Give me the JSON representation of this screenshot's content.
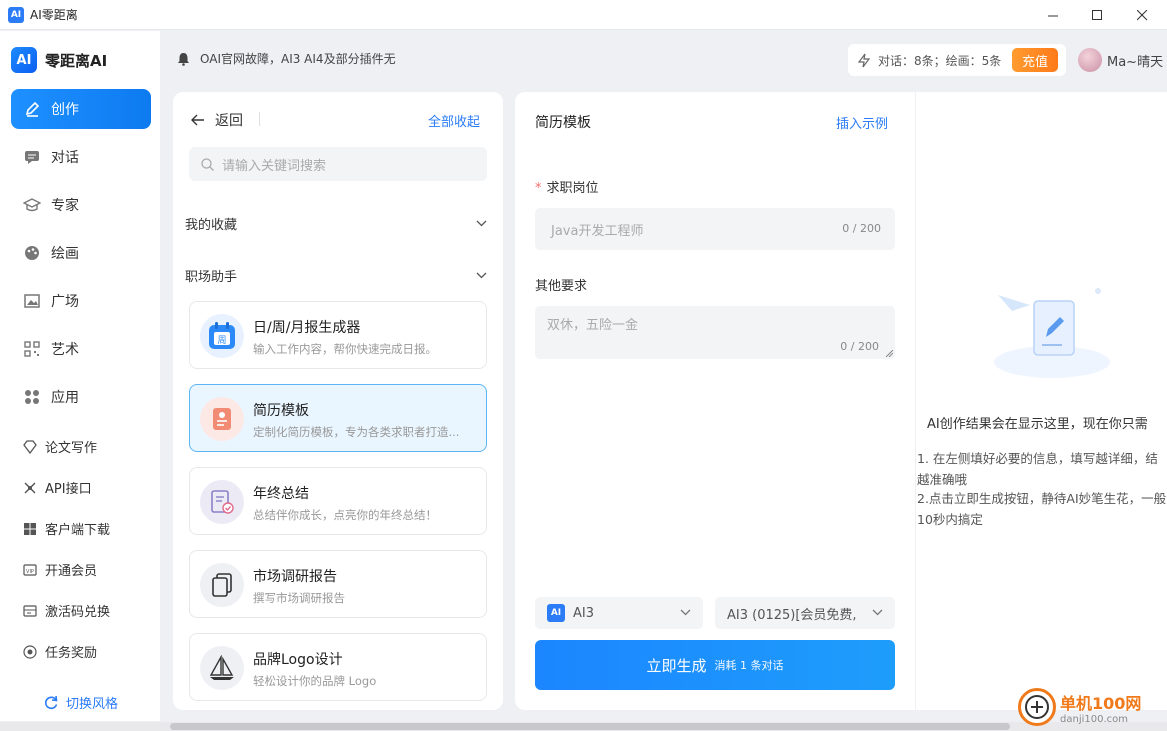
{
  "window": {
    "title": "AI零距离",
    "logo_text": "AI"
  },
  "sidebar": {
    "brand": "零距离AI",
    "brand_logo": "AI",
    "primary": [
      {
        "label": "创作",
        "icon": "pen-icon"
      },
      {
        "label": "对话",
        "icon": "chat-icon"
      },
      {
        "label": "专家",
        "icon": "graduation-cap-icon"
      },
      {
        "label": "绘画",
        "icon": "palette-icon"
      },
      {
        "label": "广场",
        "icon": "image-icon"
      },
      {
        "label": "艺术",
        "icon": "qrcode-icon"
      },
      {
        "label": "应用",
        "icon": "apps-icon"
      }
    ],
    "secondary": [
      {
        "label": "论文写作",
        "icon": "diamond-icon"
      },
      {
        "label": "API接口",
        "icon": "api-icon"
      },
      {
        "label": "客户端下载",
        "icon": "windows-icon"
      },
      {
        "label": "开通会员",
        "icon": "vip-icon"
      },
      {
        "label": "激活码兑换",
        "icon": "redeem-icon"
      },
      {
        "label": "任务奖励",
        "icon": "reward-icon"
      }
    ],
    "switch_style": "切换风格"
  },
  "header": {
    "notice": "OAI官网故障，AI3 AI4及部分插件无",
    "stats": "对话：8条；绘画：5条",
    "recharge": "充值",
    "user_name": "Ma~晴天"
  },
  "list_panel": {
    "back": "返回",
    "collapse_all": "全部收起",
    "search_placeholder": "请输入关键词搜索",
    "groups": [
      {
        "label": "我的收藏"
      },
      {
        "label": "职场助手"
      }
    ],
    "cards": [
      {
        "title": "日/周/月报生成器",
        "desc": "输入工作内容，帮你快速完成日报。",
        "icon": "calendar-icon"
      },
      {
        "title": "简历模板",
        "desc": "定制化简历模板，专为各类求职者打造...",
        "icon": "resume-icon"
      },
      {
        "title": "年终总结",
        "desc": "总结伴你成长，点亮你的年终总结！",
        "icon": "summary-icon"
      },
      {
        "title": "市场调研报告",
        "desc": "撰写市场调研报告",
        "icon": "document-icon"
      },
      {
        "title": "品牌Logo设计",
        "desc": "轻松设计你的品牌 Logo",
        "icon": "sailboat-icon"
      }
    ]
  },
  "form": {
    "title": "简历模板",
    "insert_example": "插入示例",
    "job_label": "求职岗位",
    "job_placeholder": "Java开发工程师",
    "job_counter": "0 / 200",
    "other_label": "其他要求",
    "other_placeholder": "双休，五险一金",
    "other_counter": "0 / 200",
    "model_select": "AI3",
    "model_version": "AI3 (0125)[会员免费,",
    "generate_main": "立即生成",
    "generate_sub": "消耗 1 条对话"
  },
  "result": {
    "title": "AI创作结果会在显示这里，现在你只需",
    "tip1_line1": "1. 在左侧填好必要的信息，填写越详细，结",
    "tip1_line2": "越准确哦",
    "tip2_line1": "2.点击立即生成按钮，静待AI妙笔生花，一般",
    "tip2_line2": "10秒内搞定"
  },
  "watermark": {
    "line1": "单机100网",
    "line2": "danji100.com"
  },
  "colors": {
    "accent": "#2b7cf6",
    "recharge": "#ff8a25"
  }
}
